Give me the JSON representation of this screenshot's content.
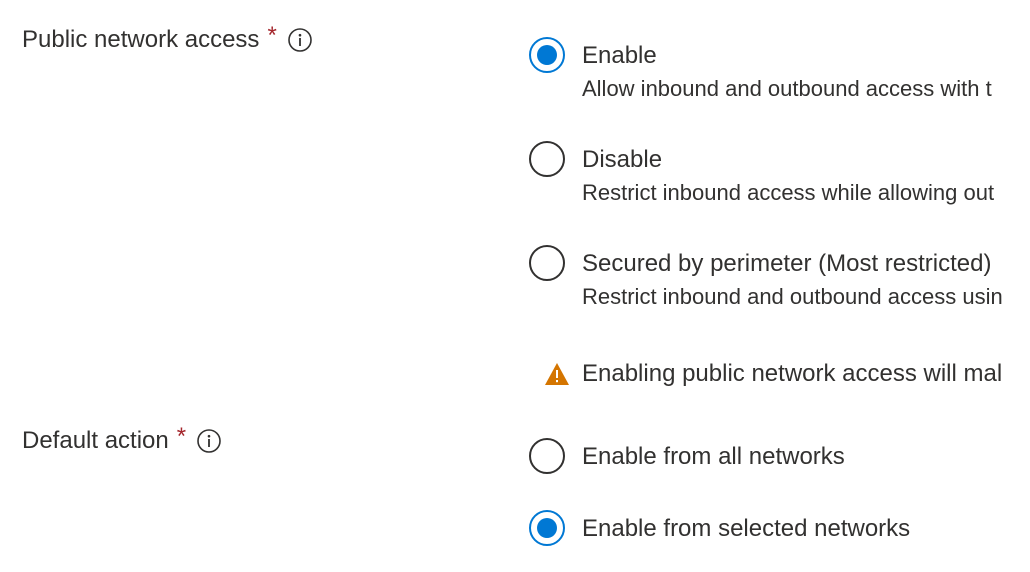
{
  "public_network_access": {
    "label": "Public network access",
    "required_mark": "*",
    "options": [
      {
        "label": "Enable",
        "description": "Allow inbound and outbound access with t",
        "selected": true
      },
      {
        "label": "Disable",
        "description": "Restrict inbound access while allowing out",
        "selected": false
      },
      {
        "label": "Secured by perimeter (Most restricted)",
        "description": "Restrict inbound and outbound access usin",
        "selected": false
      }
    ],
    "warning": "Enabling public network access will mal"
  },
  "default_action": {
    "label": "Default action",
    "required_mark": "*",
    "options": [
      {
        "label": "Enable from all networks",
        "selected": false
      },
      {
        "label": "Enable from selected networks",
        "selected": true
      }
    ]
  },
  "colors": {
    "accent": "#0078d4",
    "warning": "#d47500",
    "required": "#a4262c"
  }
}
